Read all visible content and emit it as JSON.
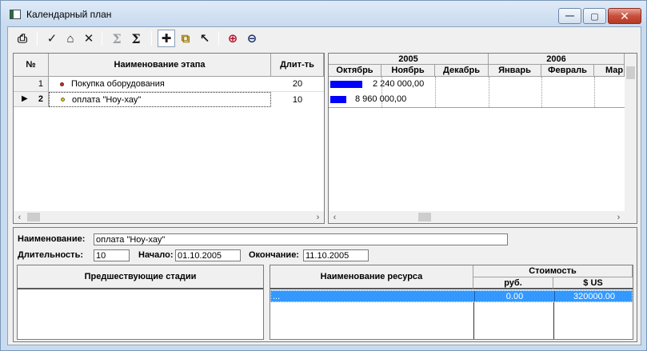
{
  "window": {
    "title": "Календарный план",
    "minimize": "—",
    "maximize": "▢",
    "close": "✕"
  },
  "toolbar": {
    "items": [
      {
        "icon": "report-icon",
        "glyph": "⎙"
      },
      {
        "icon": "check-icon",
        "glyph": "✓"
      },
      {
        "icon": "factory-icon",
        "glyph": "⌂"
      },
      {
        "icon": "delete-icon",
        "glyph": "✕"
      },
      {
        "icon": "sigma-left-icon",
        "glyph": "Σ"
      },
      {
        "icon": "sigma-right-icon",
        "glyph": "Σ"
      },
      {
        "icon": "add-icon",
        "glyph": "✚"
      },
      {
        "icon": "hierarchy-icon",
        "glyph": "⧉"
      },
      {
        "icon": "pointer-icon",
        "glyph": "↖"
      },
      {
        "icon": "zoom-in-icon",
        "glyph": "⊕"
      },
      {
        "icon": "zoom-out-icon",
        "glyph": "⊖"
      }
    ]
  },
  "stages": {
    "columns": {
      "num": "№",
      "name": "Наименование этапа",
      "duration": "Длит-ть"
    },
    "rows": [
      {
        "marker": "",
        "num": "1",
        "name": "Покупка оборудования",
        "duration": "20"
      },
      {
        "marker": "▶",
        "num": "2",
        "name": "оплата \"Ноу-хау\"",
        "duration": "10"
      }
    ]
  },
  "gantt": {
    "years": [
      {
        "label": "2005"
      },
      {
        "label": "2006"
      }
    ],
    "months": [
      {
        "label": "Октябрь"
      },
      {
        "label": "Ноябрь"
      },
      {
        "label": "Декабрь"
      },
      {
        "label": "Январь"
      },
      {
        "label": "Февраль"
      },
      {
        "label": "Мар"
      }
    ],
    "bars": [
      {
        "label": "2 240 000,00"
      },
      {
        "label": "8 960 000,00"
      }
    ]
  },
  "details": {
    "name_label": "Наименование:",
    "name_value": "оплата \"Ноу-хау\"",
    "duration_label": "Длительность:",
    "duration_value": "10",
    "start_label": "Начало:",
    "start_value": "01.10.2005",
    "end_label": "Окончание:",
    "end_value": "11.10.2005"
  },
  "predecessors": {
    "header": "Предшествующие стадии"
  },
  "resources": {
    "name_header": "Наименование ресурса",
    "cost_header": "Стоимость",
    "rub_header": "руб.",
    "usd_header": "$ US",
    "rows": [
      {
        "name": "...",
        "rub": "0.00",
        "usd": "320000.00"
      }
    ]
  },
  "colors": {
    "accent": "#0000ff",
    "selection": "#3399ff",
    "window_frame": "#c9dbef"
  }
}
